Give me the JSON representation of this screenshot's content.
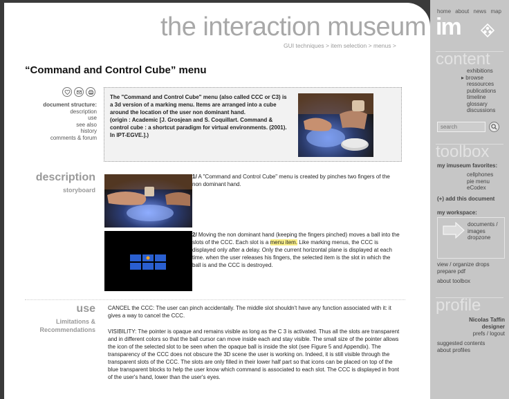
{
  "site": {
    "title": "the interaction museum",
    "breadcrumb": [
      "GUI techniques",
      "item selection",
      "menus"
    ],
    "breadcrumb_sep": " > ",
    "page_title": "“Command and Control Cube” menu"
  },
  "doc_structure": {
    "heading": "document structure:",
    "links": [
      "description",
      "use",
      "see also",
      "history",
      "comments & forum"
    ]
  },
  "intro": {
    "text": "The \"Command and Control Cube\" menu (also called CCC or C3) is a 3d version of a marking menu.  Items are arranged into a cube around the location of the user non dominant hand.",
    "origin": "(origin : Academic  [J. Grosjean and S. Coquillart. Command & control cube : a shortcut paradigm for virtual environments. (2001). In IPT-EGVE.].)"
  },
  "description": {
    "title": "description",
    "subtitle": "storyboard",
    "step1_num": "1/",
    "step1_text": " A \"Command and Control Cube\" menu is created by pinches two fingers of the non dominant hand.",
    "step2_num": "2/",
    "step2_a": " Moving the non dominant hand (keeping the fingers pinched) moves a ball into the slots of the CCC. Each slot is a ",
    "step2_link": "menu item.",
    "step2_b": "  Like marking menus, the CCC is displayed only after a delay. Only the current horizontal plane is displayed at each time.  when the user releases his fingers, the selected item is the slot in which the ball is and the CCC is destroyed."
  },
  "use": {
    "title": "use",
    "subtitle": "Limitations & Recommendations",
    "para1": "CANCEL the CCC: The user can pinch accidentally. The middle slot shouldn't have any function associated with it: it gives a way to cancel the CCC.",
    "para2": "VISIBILITY: The pointer is opaque and remains visible as long as the C 3 is activated. Thus all the slots are transparent and in different colors so that the ball cursor can move inside each and stay visible. The small size of the pointer allows the icon of the selected slot to be seen when the opaque ball is inside the slot (see Figure 5 and Appendix). The transparency of the CCC does not obscure the 3D scene the user is working on. Indeed, it is still visible through the transparent slots of the CCC. The slots are only filled in their lower half part so that icons can be placed on top of the blue transparent blocks to help the user know which command is associated to each slot. The CCC is displayed in front of the user's hand, lower than the user's eyes."
  },
  "sidebar": {
    "topnav": [
      "home",
      "about",
      "news",
      "map"
    ],
    "logo": "im",
    "content_head": "content",
    "content_links": [
      "exhibitions",
      "browse",
      "ressources",
      "publications",
      "timeline",
      "glossary",
      "discussions"
    ],
    "browse_marker": "▸",
    "search_placeholder": "search",
    "toolbox_head": "toolbox",
    "favorites_label": "my imuseum favorites:",
    "favorites": [
      "cellphones",
      "pie menu",
      "eCodex"
    ],
    "add_doc": "(+) add this document",
    "workspace_label": "my workspace:",
    "dropzone": [
      "documents /",
      "images",
      "dropzone"
    ],
    "tools": [
      "view / organize drops",
      "prepare pdf"
    ],
    "about_toolbox": "about toolbox",
    "profile_head": "profile",
    "profile_name": "Nicolas Taffin",
    "profile_role": "designer",
    "profile_links": "prefs / logout",
    "profile_extra": [
      "suggested contents",
      "about profiles"
    ]
  }
}
